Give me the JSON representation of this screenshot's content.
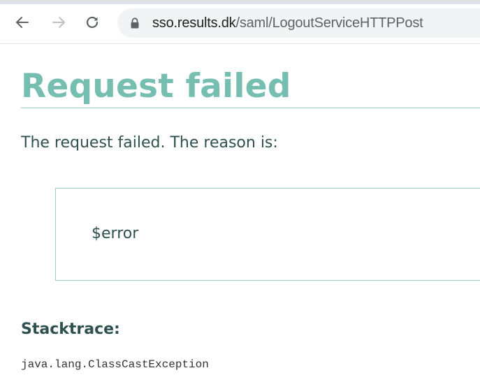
{
  "browser": {
    "url_host": "sso.results.dk",
    "url_path": "/saml/LogoutServiceHTTPPost",
    "back_icon": "back-arrow-icon",
    "forward_icon": "forward-arrow-icon",
    "reload_icon": "reload-icon",
    "lock_icon": "lock-icon"
  },
  "page": {
    "title": "Request failed",
    "intro": "The request failed. The reason is:",
    "error_message": "$error",
    "stacktrace_heading": "Stacktrace:",
    "stacktrace": "java.lang.ClassCastException"
  },
  "colors": {
    "title": "#76bfb0",
    "rule": "#9ccfc4",
    "text": "#2f5050"
  }
}
